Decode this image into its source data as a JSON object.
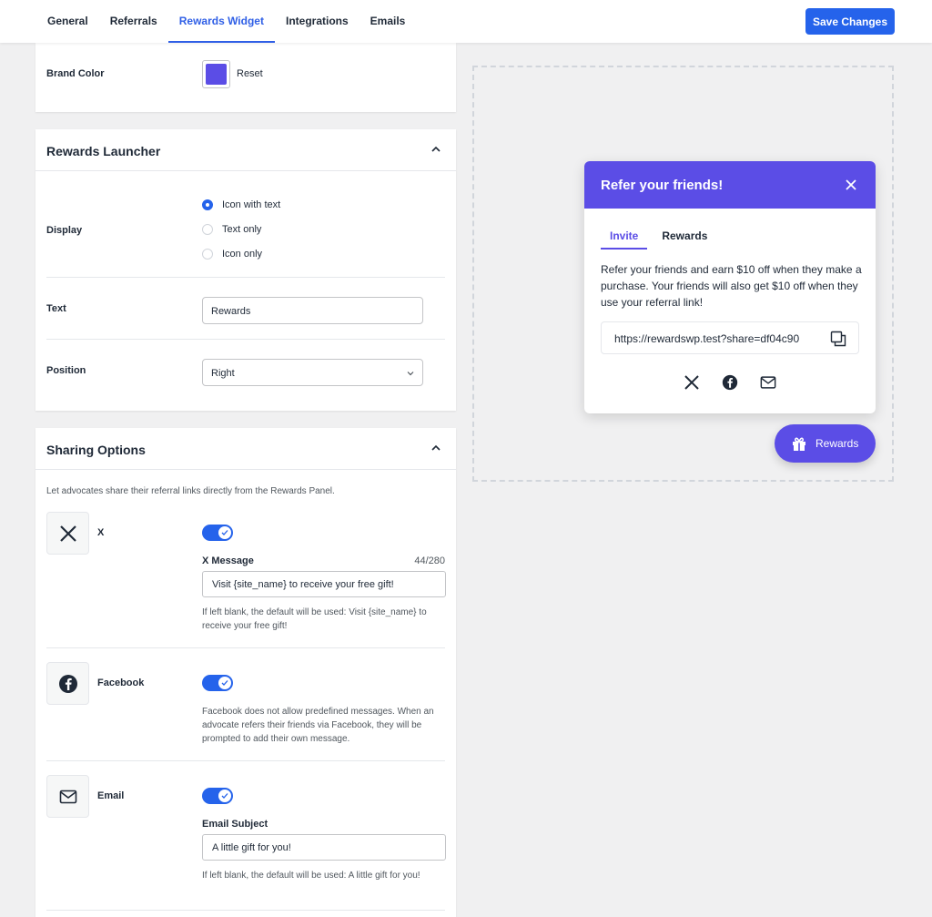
{
  "nav": {
    "tabs": [
      "General",
      "Referrals",
      "Rewards Widget",
      "Integrations",
      "Emails"
    ],
    "active_tab": "Rewards Widget",
    "save_label": "Save Changes"
  },
  "brand": {
    "label": "Brand Color",
    "color": "#5b4de6",
    "reset_label": "Reset"
  },
  "launcher_settings": {
    "title": "Rewards Launcher",
    "display_label": "Display",
    "display_options": [
      "Icon with text",
      "Text only",
      "Icon only"
    ],
    "display_selected": "Icon with text",
    "text_label": "Text",
    "text_value": "Rewards",
    "position_label": "Position",
    "position_value": "Right"
  },
  "sharing": {
    "title": "Sharing Options",
    "description": "Let advocates share their referral links directly from the Rewards Panel.",
    "x": {
      "name": "X",
      "enabled": true,
      "message_label": "X Message",
      "counter": "44/280",
      "message_value": "Visit {site_name} to receive your free gift!",
      "help": "If left blank, the default will be used: Visit {site_name} to receive your free gift!"
    },
    "facebook": {
      "name": "Facebook",
      "enabled": true,
      "help": "Facebook does not allow predefined messages. When an advocate refers their friends via Facebook, they will be prompted to add their own message."
    },
    "email": {
      "name": "Email",
      "enabled": true,
      "subject_label": "Email Subject",
      "subject_value": "A little gift for you!",
      "help": "If left blank, the default will be used: A little gift for you!"
    }
  },
  "preview": {
    "header_title": "Refer your friends!",
    "tabs": [
      "Invite",
      "Rewards"
    ],
    "active_tab": "Invite",
    "body_text": "Refer your friends and earn $10 off when they make a purchase. Your friends will also get $10 off when they use your referral link!",
    "referral_link": "https://rewardswp.test?share=df04c90",
    "launcher_label": "Rewards"
  },
  "colors": {
    "accent": "#2563eb",
    "brand": "#5b4de6"
  }
}
